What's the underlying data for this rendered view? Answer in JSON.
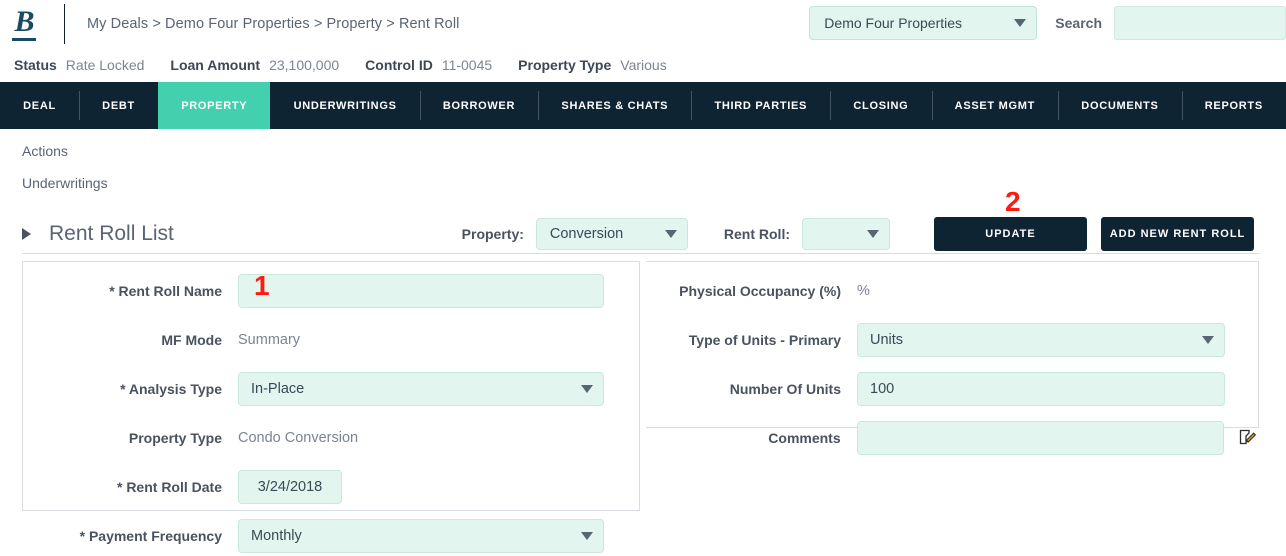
{
  "header": {
    "logo_text": "B",
    "breadcrumb": "My Deals > Demo Four Properties > Property > Rent Roll",
    "deal_selector_value": "Demo Four Properties",
    "search_label": "Search",
    "search_value": "",
    "search_placeholder": ""
  },
  "status_bar": [
    {
      "label": "Status",
      "value": "Rate Locked"
    },
    {
      "label": "Loan Amount",
      "value": "23,100,000"
    },
    {
      "label": "Control ID",
      "value": "11-0045"
    },
    {
      "label": "Property Type",
      "value": "Various"
    }
  ],
  "nav": {
    "active": "PROPERTY",
    "items": [
      "DEAL",
      "DEBT",
      "PROPERTY",
      "UNDERWRITINGS",
      "BORROWER",
      "SHARES & CHATS",
      "THIRD PARTIES",
      "CLOSING",
      "ASSET MGMT",
      "DOCUMENTS",
      "REPORTS"
    ]
  },
  "side_actions": {
    "actions_label": "Actions",
    "underwritings_label": "Underwritings"
  },
  "toolbar": {
    "section_title": "Rent Roll List",
    "property_label": "Property:",
    "property_value": "Conversion",
    "rent_roll_label": "Rent Roll:",
    "rent_roll_value": "",
    "update_label": "UPDATE",
    "add_new_label": "ADD NEW RENT ROLL"
  },
  "annotations": {
    "one": "1",
    "two": "2"
  },
  "left_panel": {
    "rent_roll_name_label": "* Rent Roll Name",
    "rent_roll_name_value": "",
    "mf_mode_label": "MF Mode",
    "mf_mode_value": "Summary",
    "analysis_type_label": "* Analysis Type",
    "analysis_type_value": "In-Place",
    "property_type_label": "Property Type",
    "property_type_value": "Condo Conversion",
    "rent_roll_date_label": "* Rent Roll Date",
    "rent_roll_date_value": "3/24/2018",
    "payment_frequency_label": "* Payment Frequency",
    "payment_frequency_value": "Monthly"
  },
  "right_panel": {
    "physical_occupancy_label": "Physical Occupancy (%)",
    "physical_occupancy_value": "%",
    "type_of_units_label": "Type of Units - Primary",
    "type_of_units_value": "Units",
    "number_of_units_label": "Number Of Units",
    "number_of_units_value": "100",
    "comments_label": "Comments",
    "comments_value": ""
  },
  "colors": {
    "nav_background": "#0e2433",
    "accent_teal": "#42d0ae",
    "field_background": "#e2f5ef",
    "annotation_red": "#ff1a0d",
    "logo_blue": "#1b4a63"
  }
}
